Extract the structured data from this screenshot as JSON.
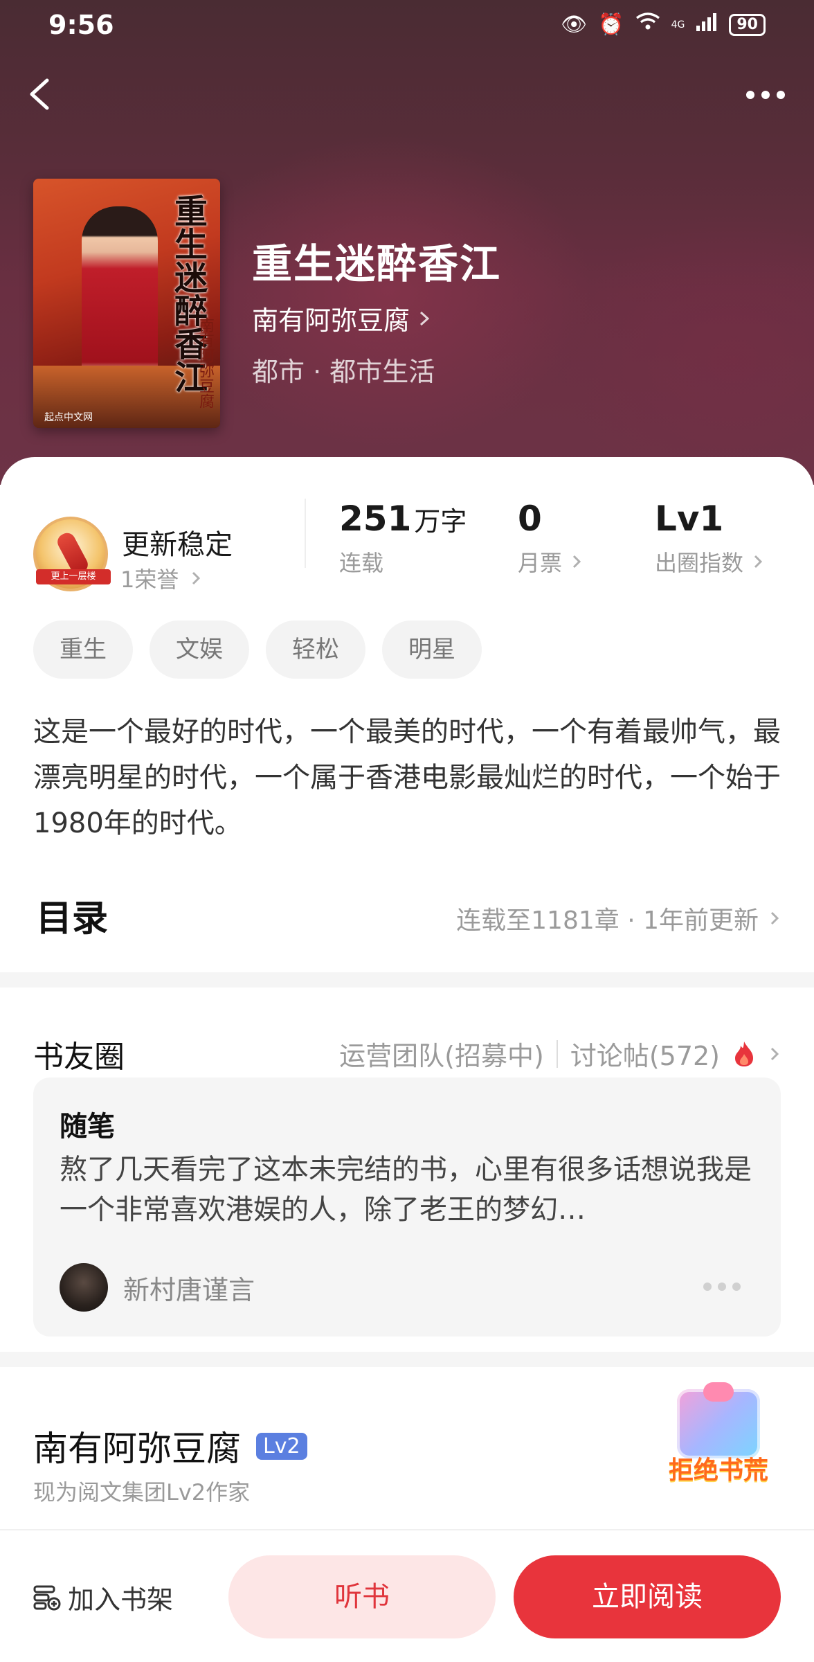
{
  "status_bar": {
    "time": "9:56",
    "battery": "90",
    "network": "4G"
  },
  "book": {
    "title": "重生迷醉香江",
    "author": "南有阿弥豆腐",
    "genre": "都市 · 都市生活"
  },
  "cover": {
    "title": "重生迷醉香江",
    "author": "南有阿弥豆腐",
    "publisher": "起点中文网"
  },
  "honor": {
    "badge_text": "更上一层楼",
    "title": "更新稳定",
    "subtitle": "1荣誉"
  },
  "stats": [
    {
      "value": "251",
      "unit": "万字",
      "label": "连载"
    },
    {
      "value": "0",
      "unit": "",
      "label": "月票"
    },
    {
      "value": "Lv1",
      "unit": "",
      "label": "出圈指数"
    }
  ],
  "tags": [
    "重生",
    "文娱",
    "轻松",
    "明星"
  ],
  "synopsis": "这是一个最好的时代，一个最美的时代，一个有着最帅气，最漂亮明星的时代，一个属于香港电影最灿烂的时代，一个始于1980年的时代。",
  "toc": {
    "title": "目录",
    "info": "连载至1181章 · 1年前更新"
  },
  "book_circle": {
    "title": "书友圈",
    "ops_team": "运营团队(招募中)",
    "discussions": "讨论帖(572)",
    "post": {
      "category": "随笔",
      "content": "熬了几天看完了这本未完结的书，心里有很多话想说我是一个非常喜欢港娱的人，除了老王的梦幻…",
      "user": "新村唐谨言"
    }
  },
  "author_section": {
    "name": "南有阿弥豆腐",
    "level": "Lv2",
    "description": "现为阅文集团Lv2作家",
    "promo": "拒绝书荒"
  },
  "bottom_bar": {
    "add_shelf": "加入书架",
    "listen": "听书",
    "read": "立即阅读"
  },
  "colors": {
    "accent": "#e8343c",
    "accent_light": "#fde6e6",
    "level_badge": "#5b7fe0",
    "hot": "#e8343c"
  }
}
